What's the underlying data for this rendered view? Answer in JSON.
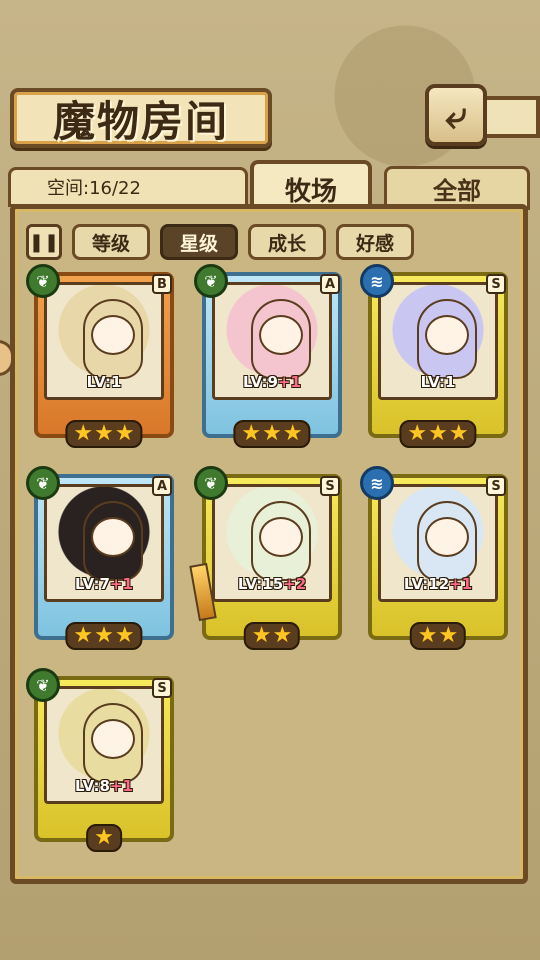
{
  "header": {
    "title": "魔物房间",
    "back_icon": "back-arrow-icon"
  },
  "tabs": {
    "space_label": "空间:16/22",
    "main": "牧场",
    "other": "全部"
  },
  "filters": {
    "pause_icon": "pause-icon",
    "items": [
      "等级",
      "星级",
      "成长",
      "好感"
    ],
    "active_index": 1
  },
  "monsters": [
    {
      "rank": "B",
      "element": "grass",
      "level": "LV:1",
      "plus": "",
      "stars": 3,
      "frame": "orange",
      "accent": "#e8d7a8"
    },
    {
      "rank": "A",
      "element": "grass",
      "level": "LV:9",
      "plus": "+1",
      "stars": 3,
      "frame": "blue",
      "accent": "#f5c5cf"
    },
    {
      "rank": "S",
      "element": "water",
      "level": "LV:1",
      "plus": "",
      "stars": 3,
      "frame": "yellow",
      "accent": "#c9c7f2"
    },
    {
      "rank": "A",
      "element": "grass",
      "level": "LV:7",
      "plus": "+1",
      "stars": 3,
      "frame": "blue",
      "accent": "#2a2220"
    },
    {
      "rank": "S",
      "element": "grass",
      "level": "LV:15",
      "plus": "+2",
      "stars": 2,
      "frame": "yellow",
      "accent": "#e9f0d8"
    },
    {
      "rank": "S",
      "element": "water",
      "level": "LV:12",
      "plus": "+1",
      "stars": 2,
      "frame": "yellow",
      "accent": "#d9e6f4"
    },
    {
      "rank": "S",
      "element": "grass",
      "level": "LV:8",
      "plus": "+1",
      "stars": 1,
      "frame": "yellow",
      "accent": "#e9dca0"
    }
  ]
}
